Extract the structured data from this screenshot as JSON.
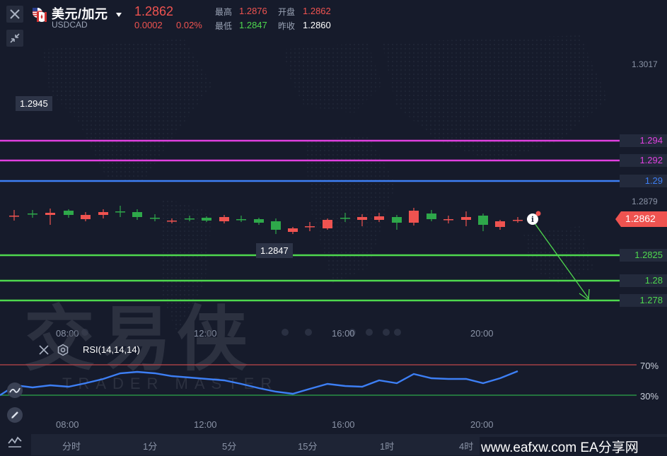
{
  "header": {
    "close_icon": "close-icon",
    "collapse_icon": "collapse-icon",
    "flag_icon": "us-ca-flag-icon",
    "symbol_name": "美元/加元",
    "symbol_code": "USDCAD",
    "dropdown_icon": "caret-down-icon",
    "last_price": "1.2862",
    "change": "0.0002",
    "change_pct": "0.02%",
    "stats": {
      "high_label": "最高",
      "high_value": "1.2876",
      "open_label": "开盘",
      "open_value": "1.2862",
      "low_label": "最低",
      "low_value": "1.2847",
      "prev_close_label": "昨收",
      "prev_close_value": "1.2860"
    }
  },
  "price_axis": {
    "top_label": "1.3017",
    "mid_label": "1.2879",
    "current_price_tag": "1.2862"
  },
  "tooltips": {
    "high_marker": "1.2945",
    "low_marker": "1.2847"
  },
  "levels": [
    {
      "price": 1.294,
      "label": "1.294",
      "color": "#e040e0"
    },
    {
      "price": 1.292,
      "label": "1.292",
      "color": "#e040e0"
    },
    {
      "price": 1.29,
      "label": "1.29",
      "color": "#3d7ff5"
    },
    {
      "price": 1.2825,
      "label": "1.2825",
      "color": "#4ed84e"
    },
    {
      "price": 1.28,
      "label": "1.28",
      "color": "#4ed84e"
    },
    {
      "price": 1.278,
      "label": "1.278",
      "color": "#4ed84e"
    }
  ],
  "time_axis": [
    "08:00",
    "12:00",
    "16:00",
    "20:00"
  ],
  "rsi": {
    "label": "RSI(14,14,14)",
    "upper_label": "70%",
    "lower_label": "30%",
    "upper_color": "#c0464a",
    "lower_color": "#2ea84a",
    "line_color": "#3d7ff5"
  },
  "timeframes": [
    "分时",
    "1分",
    "5分",
    "15分",
    "1时",
    "4时"
  ],
  "sidebar_icons": [
    "close-icon",
    "settings-icon",
    "draw-tool-icon",
    "pen-icon",
    "indicator-icon"
  ],
  "watermark": {
    "text": "交易侠",
    "sub": "TRADER MASTER"
  },
  "brand": "www.eafxw.com  EA分享网",
  "colors": {
    "up": "#2ea84a",
    "down": "#ef5350",
    "bg": "#161b2b"
  }
}
